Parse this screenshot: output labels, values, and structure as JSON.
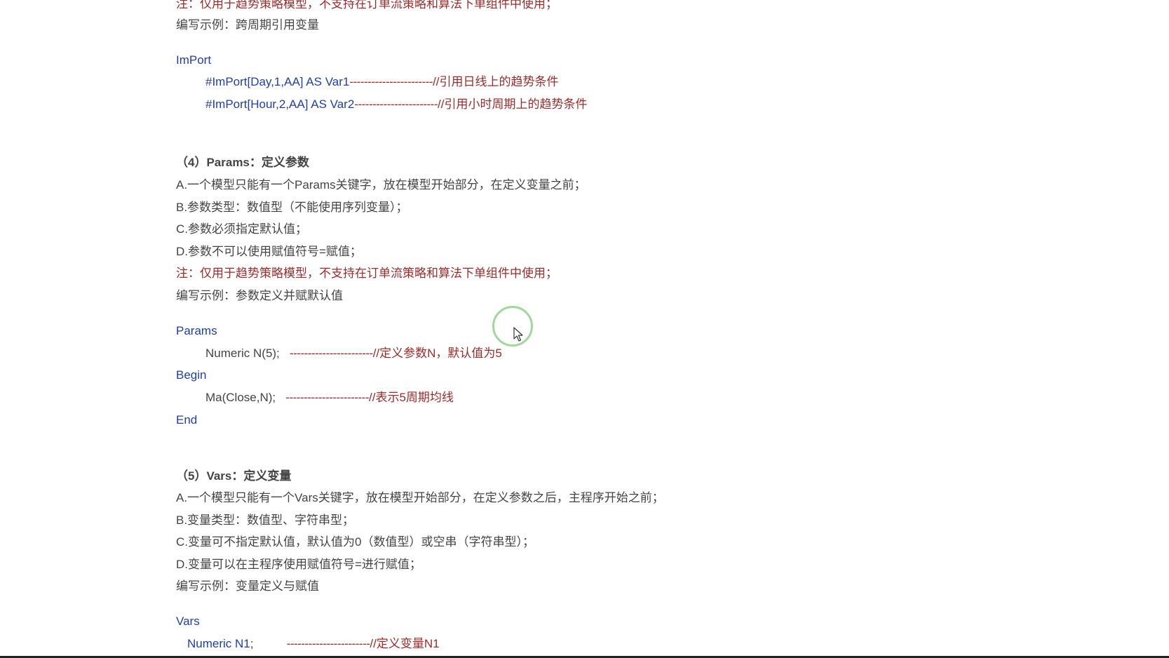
{
  "top_note_partial": "注：仅用于趋势策略模型，不支持在订单流策略和算法下单组件中使用；",
  "top_example": "编写示例：跨周期引用变量",
  "import_block": {
    "keyword": "ImPort",
    "lines": [
      {
        "code": "#ImPort[Day,1,AA] AS Var1",
        "dashes": "-----------------------",
        "comment": "//引用日线上的趋势条件"
      },
      {
        "code": "#ImPort[Hour,2,AA] AS Var2",
        "dashes": "-----------------------",
        "comment": "//引用小时周期上的趋势条件"
      }
    ]
  },
  "params_section": {
    "heading": "（4）Params：定义参数",
    "items": [
      "A.一个模型只能有一个Params关键字，放在模型开始部分，在定义变量之前；",
      "B.参数类型：数值型（不能使用序列变量）；",
      "C.参数必须指定默认值；",
      "D.参数不可以使用赋值符号=赋值；"
    ],
    "note": "注：仅用于趋势策略模型，不支持在订单流策略和算法下单组件中使用；",
    "example": "编写示例：参数定义并赋默认值",
    "code": {
      "kw_params": "Params",
      "param_line": {
        "code": "Numeric N(5);",
        "dashes": "-----------------------",
        "comment": "//定义参数N，默认值为5"
      },
      "kw_begin": "Begin",
      "body_line": {
        "code": "Ma(Close,N);",
        "dashes": "-----------------------",
        "comment": "//表示5周期均线"
      },
      "kw_end": "End"
    }
  },
  "vars_section": {
    "heading": "（5）Vars：定义变量",
    "items": [
      "A.一个模型只能有一个Vars关键字，放在模型开始部分，在定义参数之后，主程序开始之前；",
      "B.变量类型：数值型、字符串型；",
      "C.变量可不指定默认值，默认值为0（数值型）或空串（字符串型）；",
      "D.变量可以在主程序使用赋值符号=进行赋值；"
    ],
    "example": "编写示例：变量定义与赋值",
    "code": {
      "kw_vars": "Vars",
      "var_line": {
        "code": "Numeric N1;",
        "dashes": "-----------------------",
        "comment": "//定义变量N1"
      }
    }
  },
  "colors": {
    "keyword_blue": "#1f3fa8",
    "note_red": "#9c2b2b",
    "body_text": "#444444",
    "cursor_ring": "#8fd18a"
  }
}
